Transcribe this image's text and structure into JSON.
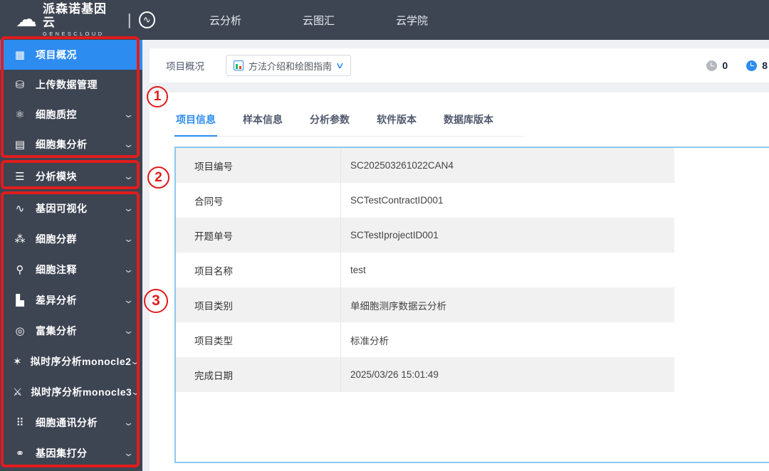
{
  "icons": {
    "cloud": "☁",
    "swirl": "∿",
    "grid": "▦",
    "database": "⛁",
    "qc": "⚛",
    "cellset": "▤",
    "modules": "☰",
    "dna": "∿",
    "cluster": "⁂",
    "annotate": "⚲",
    "diff": "▙",
    "enrich": "◎",
    "monocle2": "✶",
    "monocle3": "⚔",
    "comm": "⠿",
    "score": "⚭",
    "chevron_down": "⌄",
    "dropdown_chevron": "∨"
  },
  "navbar": {
    "brand_cn": "派森诺基因云",
    "brand_en": "GENESCLOUD",
    "items": [
      {
        "label": "云分析"
      },
      {
        "label": "云图汇"
      },
      {
        "label": "云学院"
      }
    ]
  },
  "sidebar": {
    "items": [
      {
        "label": "项目概况",
        "active": true
      },
      {
        "label": "上传数据管理"
      },
      {
        "label": "细胞质控"
      },
      {
        "label": "细胞集分析"
      },
      {
        "label": "分析模块"
      },
      {
        "label": "基因可视化"
      },
      {
        "label": "细胞分群"
      },
      {
        "label": "细胞注释"
      },
      {
        "label": "差异分析"
      },
      {
        "label": "富集分析"
      },
      {
        "label": "拟时序分析monocle2"
      },
      {
        "label": "拟时序分析monocle3"
      },
      {
        "label": "细胞通讯分析"
      },
      {
        "label": "基因集打分"
      }
    ]
  },
  "annotations": {
    "n1": "1",
    "n2": "2",
    "n3": "3"
  },
  "breadcrumb": {
    "title": "项目概况",
    "guide_button_label": "方法介绍和绘图指南"
  },
  "status": {
    "pending_count": "0",
    "running_count": "8"
  },
  "tabs": [
    {
      "label": "项目信息"
    },
    {
      "label": "样本信息"
    },
    {
      "label": "分析参数"
    },
    {
      "label": "软件版本"
    },
    {
      "label": "数据库版本"
    }
  ],
  "project_table": {
    "rows": [
      {
        "label": "项目编号",
        "value": "SC202503261022CAN4"
      },
      {
        "label": "合同号",
        "value": "SCTestContractID001"
      },
      {
        "label": "开题单号",
        "value": "SCTestIprojectID001"
      },
      {
        "label": "项目名称",
        "value": "test"
      },
      {
        "label": "项目类别",
        "value": "单细胞测序数据云分析"
      },
      {
        "label": "项目类型",
        "value": "标准分析"
      },
      {
        "label": "完成日期",
        "value": "2025/03/26 15:01:49"
      }
    ]
  },
  "colors": {
    "accent_blue": "#2d8cf0",
    "dark_chrome": "#3d4452",
    "annotation_red": "#e11c1c",
    "table_border_blue": "#8cc8f0",
    "stripe_gray": "#f1f1f1"
  }
}
